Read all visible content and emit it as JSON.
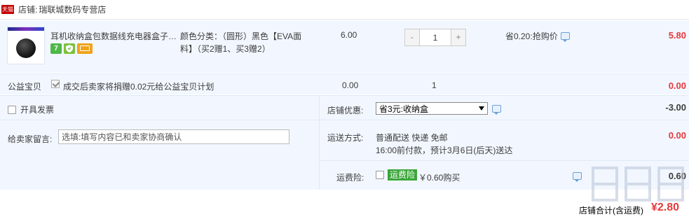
{
  "shop": {
    "badge": "天猫",
    "label": "店铺:",
    "name": "瑞联城数码专营店"
  },
  "item": {
    "title": "耳机收纳盒包数据线充电器盒子…",
    "badges": [
      "7",
      "shield",
      "card"
    ],
    "sku_line1": "颜色分类：（圆形）黑色【EVA面",
    "sku_line2": "料】（买2赠1、买3赠2）",
    "price": "6.00",
    "qty_minus": "-",
    "qty": "1",
    "qty_plus": "+",
    "promo": "省0.20:抢购价",
    "subtotal": "5.80"
  },
  "charity": {
    "label": "公益宝贝",
    "text": "成交后卖家将捐赠0.02元给公益宝贝计划",
    "price": "0.00",
    "qty": "1",
    "subtotal": "0.00"
  },
  "options": {
    "invoice_label": "开具发票",
    "message_label": "给卖家留言:",
    "message_placeholder": "选填:填写内容已和卖家协商确认",
    "discount_label": "店铺优惠:",
    "discount_selected": "省3元:收纳盒",
    "discount_amount": "-3.00",
    "shipping_label": "运送方式:",
    "shipping_method": "普通配送 快递 免邮",
    "shipping_eta": "16:00前付款，预计3月6日(后天)送达",
    "shipping_amount": "0.00",
    "insurance_label": "运费险:",
    "insurance_tag": "运费险",
    "insurance_price": "￥0.60购买",
    "insurance_amount": "0.60"
  },
  "total": {
    "label": "店铺合计(含运费)",
    "amount": "¥2.80"
  },
  "colors": {
    "accent_red": "#e4393c",
    "row_bg": "#f2f7ff",
    "tmall_red": "#c40000",
    "insurance_green": "#3aa63a"
  }
}
